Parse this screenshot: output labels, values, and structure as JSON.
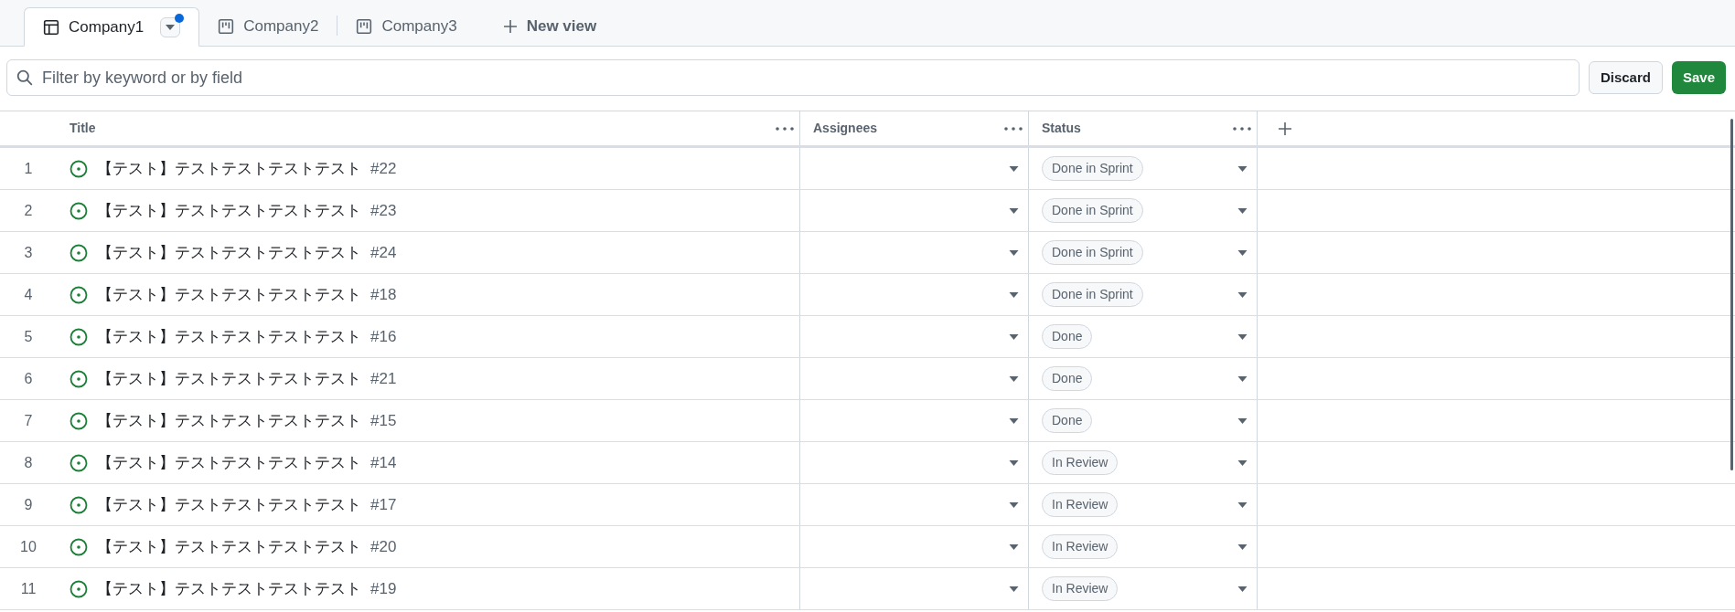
{
  "tabs": [
    {
      "label": "Company1",
      "kind": "table",
      "selected": true,
      "unsaved": true
    },
    {
      "label": "Company2",
      "kind": "board",
      "selected": false
    },
    {
      "label": "Company3",
      "kind": "board",
      "selected": false
    }
  ],
  "new_view": "New view",
  "filter": {
    "placeholder": "Filter by keyword or by field"
  },
  "buttons": {
    "discard": "Discard",
    "save": "Save"
  },
  "table": {
    "columns": [
      "Title",
      "Assignees",
      "Status"
    ],
    "rows": [
      {
        "number": "1",
        "title": "【テスト】テストテストテストテスト",
        "issue": "#22",
        "status": "Done in Sprint"
      },
      {
        "number": "2",
        "title": "【テスト】テストテストテストテスト",
        "issue": "#23",
        "status": "Done in Sprint"
      },
      {
        "number": "3",
        "title": "【テスト】テストテストテストテスト",
        "issue": "#24",
        "status": "Done in Sprint"
      },
      {
        "number": "4",
        "title": "【テスト】テストテストテストテスト",
        "issue": "#18",
        "status": "Done in Sprint"
      },
      {
        "number": "5",
        "title": "【テスト】テストテストテストテスト",
        "issue": "#16",
        "status": "Done"
      },
      {
        "number": "6",
        "title": "【テスト】テストテストテストテスト",
        "issue": "#21",
        "status": "Done"
      },
      {
        "number": "7",
        "title": "【テスト】テストテストテストテスト",
        "issue": "#15",
        "status": "Done"
      },
      {
        "number": "8",
        "title": "【テスト】テストテストテストテスト",
        "issue": "#14",
        "status": "In Review"
      },
      {
        "number": "9",
        "title": "【テスト】テストテストテストテスト",
        "issue": "#17",
        "status": "In Review"
      },
      {
        "number": "10",
        "title": "【テスト】テストテストテストテスト",
        "issue": "#20",
        "status": "In Review"
      },
      {
        "number": "11",
        "title": "【テスト】テストテストテストテスト",
        "issue": "#19",
        "status": "In Review"
      }
    ]
  }
}
